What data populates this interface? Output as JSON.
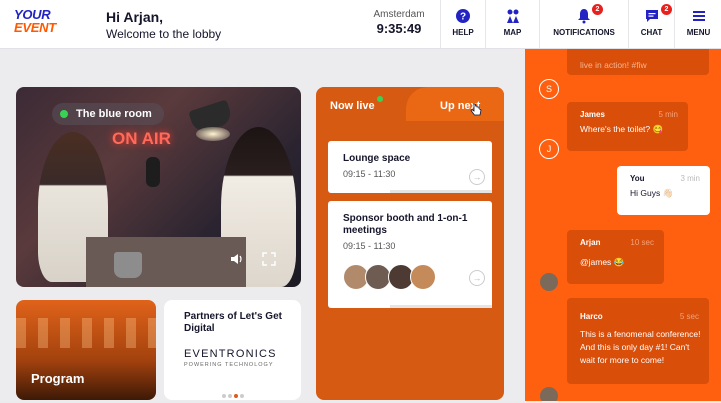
{
  "header": {
    "logo_line1": "YOUR",
    "logo_line2": "EVENT",
    "greeting": "Hi Arjan,",
    "subtitle": "Welcome to the lobby",
    "city": "Amsterdam",
    "time": "9:35:49",
    "nav": [
      {
        "label": "HELP",
        "icon": "help-icon"
      },
      {
        "label": "MAP",
        "icon": "map-icon"
      },
      {
        "label": "NOTIFICATIONS",
        "icon": "bell-icon",
        "badge": "2"
      },
      {
        "label": "CHAT",
        "icon": "chat-icon",
        "badge": "2"
      },
      {
        "label": "MENU",
        "icon": "hamburger-icon"
      }
    ]
  },
  "video": {
    "room_label": "The blue room",
    "sign": "ON AIR"
  },
  "program": {
    "label": "Program"
  },
  "partners": {
    "title": "Partners of Let's Get Digital",
    "brand": "EVENTRONICS",
    "brand_sub": "POWERING TECHNOLOGY",
    "active_dot": 2,
    "dot_count": 4
  },
  "schedule": {
    "tab_now": "Now live",
    "tab_next": "Up next",
    "items": [
      {
        "title": "Lounge space",
        "time": "09:15 - 11:30"
      },
      {
        "title": "Sponsor booth and 1-on-1 meetings",
        "time": "09:15 - 11:30"
      }
    ]
  },
  "chat": {
    "messages": [
      {
        "initial": "S",
        "name": "",
        "time": "",
        "text": "live in action! #fiw"
      },
      {
        "initial": "J",
        "name": "James",
        "time": "5 min",
        "text": "Where's the toilet? 😋"
      },
      {
        "initial": "",
        "name": "You",
        "time": "3 min",
        "text": "Hi Guys 👋🏻"
      },
      {
        "initial": "",
        "name": "Arjan",
        "time": "10 sec",
        "text": "@james 😂"
      },
      {
        "initial": "",
        "name": "Harco",
        "time": "5 sec",
        "text": "This is a fenomenal conference! And this is only day #1! Can't wait for more to come!"
      }
    ]
  },
  "colors": {
    "brand_blue": "#2323c4",
    "brand_orange": "#ff5a00",
    "chat_bg": "#ff6010",
    "schedule_bg": "#d65a12",
    "badge_red": "#e8211d",
    "live_green": "#39d353"
  }
}
